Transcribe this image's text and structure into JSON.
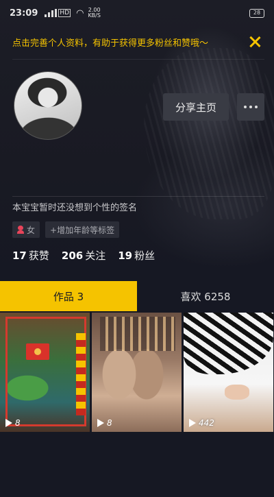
{
  "status_bar": {
    "time": "23:09",
    "signal_label": "HD",
    "wifi_icon": "wifi-icon",
    "speed": "2.00",
    "speed_unit": "KB/S",
    "battery": "28"
  },
  "notice": {
    "text": "点击完善个人资料，有助于获得更多粉丝和赞哦～",
    "color": "#f5c300",
    "close_icon": "close-icon"
  },
  "profile": {
    "avatar_icon": "avatar",
    "share_label": "分享主页",
    "more_icon": "more-icon",
    "bio": "本宝宝暂时还没想到个性的签名",
    "gender_tag": "女",
    "add_tag_label": "+增加年龄等标签"
  },
  "stats": {
    "likes_count": "17",
    "likes_label": "获赞",
    "following_count": "206",
    "following_label": "关注",
    "followers_count": "19",
    "followers_label": "粉丝"
  },
  "tabs": [
    {
      "label": "作品 3",
      "active": true
    },
    {
      "label": "喜欢 6258",
      "active": false
    }
  ],
  "videos": [
    {
      "play_count": "8"
    },
    {
      "play_count": "8"
    },
    {
      "play_count": "442"
    }
  ],
  "colors": {
    "accent": "#f5c300",
    "background": "#161823",
    "button_bg": "#393b44"
  }
}
